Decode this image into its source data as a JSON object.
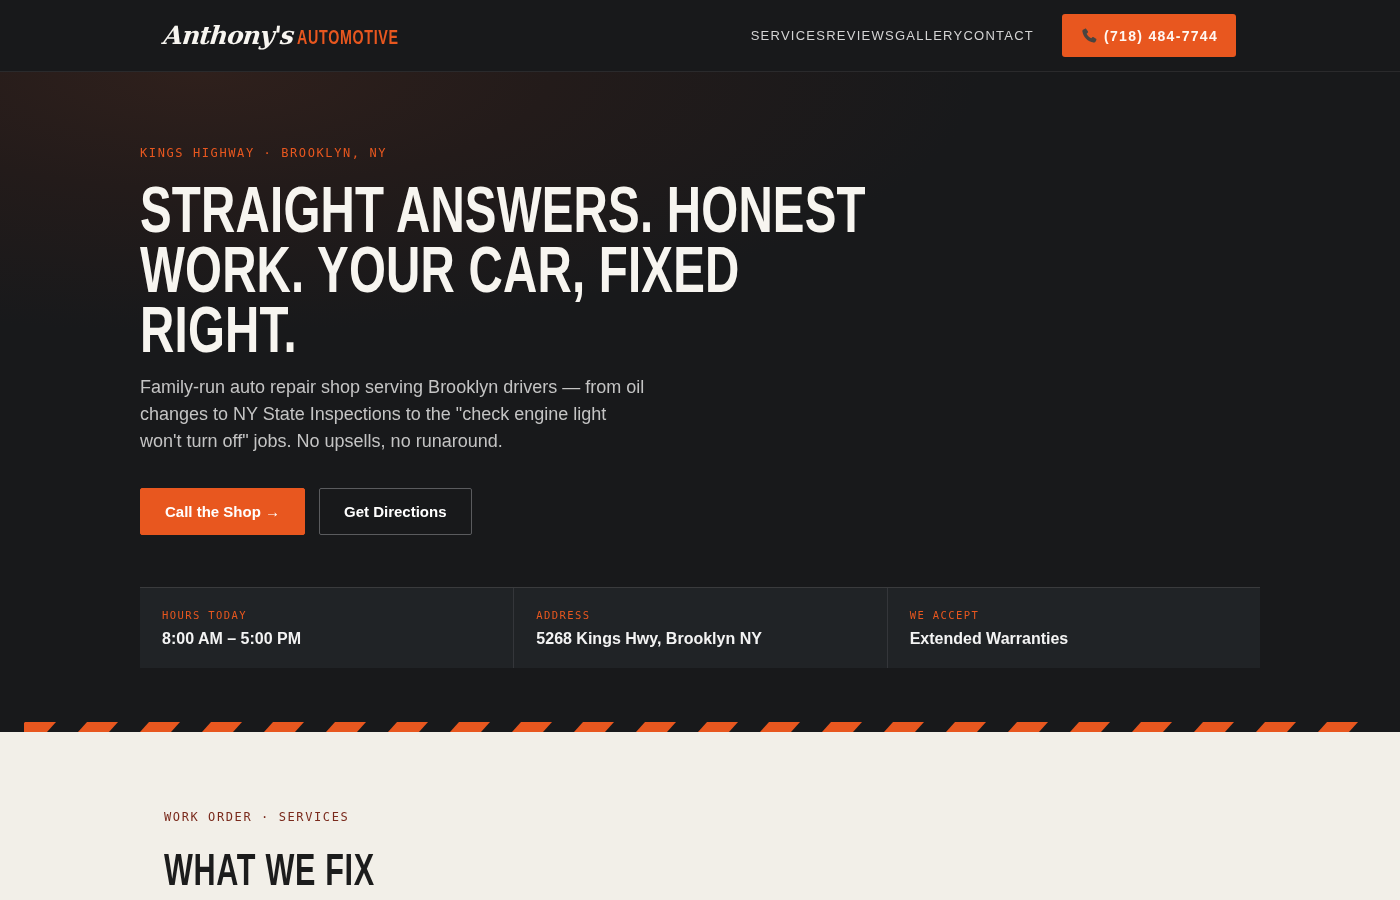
{
  "header": {
    "logo": {
      "script": "Anthony's",
      "wordmark": "AUTOMOTIVE"
    },
    "nav": [
      {
        "label": "SERVICES"
      },
      {
        "label": "REVIEWS"
      },
      {
        "label": "GALLERY"
      },
      {
        "label": "CONTACT"
      }
    ],
    "phone_button": {
      "label": "(718) 484-7744"
    }
  },
  "hero": {
    "eyebrow": "KINGS HIGHWAY · BROOKLYN, NY",
    "headline": "STRAIGHT ANSWERS. HONEST WORK. YOUR CAR, FIXED RIGHT.",
    "description": "Family-run auto repair shop serving Brooklyn drivers — from oil changes to NY State Inspections to the \"check engine light won't turn off\" jobs. No upsells, no runaround.",
    "buttons": [
      {
        "label": "Call the Shop →",
        "kind": "primary"
      },
      {
        "label": "Get Directions",
        "kind": "outline"
      }
    ],
    "info": [
      {
        "label": "HOURS TODAY",
        "value": "8:00 AM – 5:00 PM"
      },
      {
        "label": "ADDRESS",
        "value": "5268 Kings Hwy, Brooklyn NY"
      },
      {
        "label": "WE ACCEPT",
        "value": "Extended Warranties"
      }
    ]
  },
  "services": {
    "eyebrow": "WORK ORDER · SERVICES",
    "title": "WHAT WE FIX"
  }
}
